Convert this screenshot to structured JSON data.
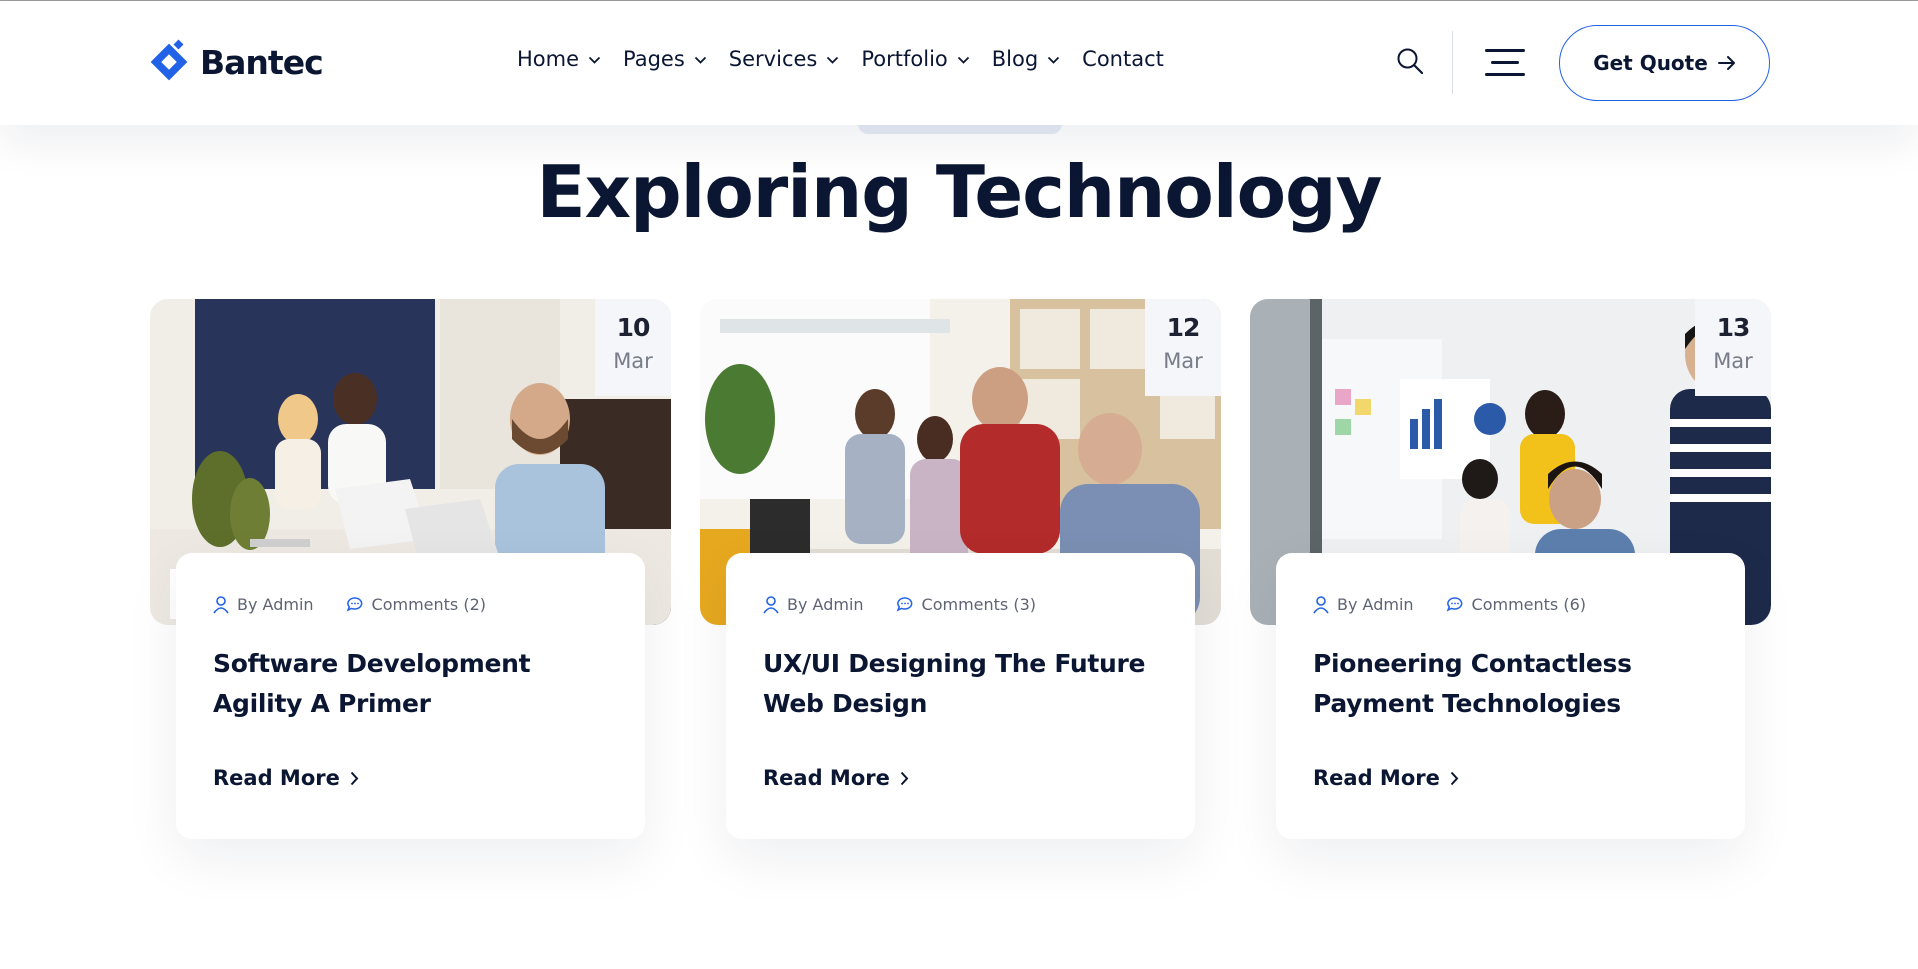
{
  "brand": {
    "name": "Bantec",
    "accent": "#2262e6",
    "navy": "#0b1633"
  },
  "nav": {
    "items": [
      {
        "label": "Home",
        "has_dropdown": true
      },
      {
        "label": "Pages",
        "has_dropdown": true
      },
      {
        "label": "Services",
        "has_dropdown": true
      },
      {
        "label": "Portfolio",
        "has_dropdown": true
      },
      {
        "label": "Blog",
        "has_dropdown": true
      },
      {
        "label": "Contact",
        "has_dropdown": false
      }
    ],
    "search_icon": "search-icon",
    "menu_icon": "hamburger-menu-icon",
    "cta_label": "Get Quote"
  },
  "section": {
    "title": "Exploring Technology"
  },
  "posts": [
    {
      "day": "10",
      "month": "Mar",
      "author": "By Admin",
      "comments": "Comments (2)",
      "title_line1": "Software Development",
      "title_line2": "Agility A Primer",
      "read_more": "Read More"
    },
    {
      "day": "12",
      "month": "Mar",
      "author": "By Admin",
      "comments": "Comments (3)",
      "title_line1": "UX/UI Designing The Future",
      "title_line2": "Web Design",
      "read_more": "Read More"
    },
    {
      "day": "13",
      "month": "Mar",
      "author": "By Admin",
      "comments": "Comments (6)",
      "title_line1": "Pioneering Contactless",
      "title_line2": "Payment Technologies",
      "read_more": "Read More"
    }
  ]
}
